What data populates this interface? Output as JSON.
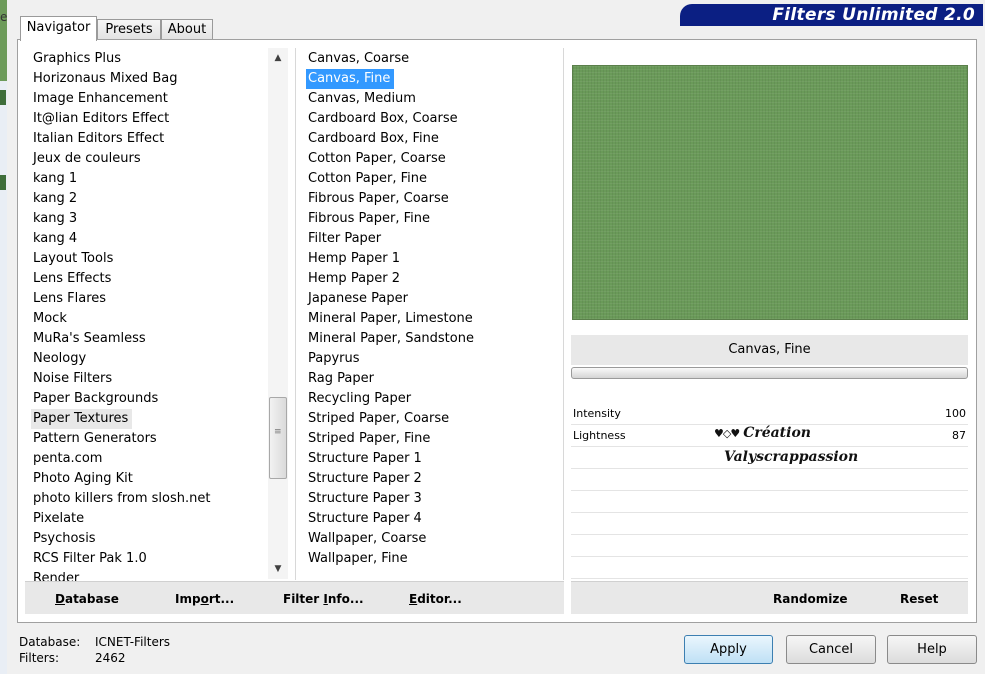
{
  "window": {
    "title": "Filters Unlimited 2.0",
    "edge_char": "e"
  },
  "tabs": [
    {
      "label": "Navigator",
      "active": true
    },
    {
      "label": "Presets",
      "active": false
    },
    {
      "label": "About",
      "active": false
    }
  ],
  "categories": [
    "Graphics Plus",
    "Horizonaus Mixed Bag",
    "Image Enhancement",
    "It@lian Editors Effect",
    "Italian Editors Effect",
    "Jeux de couleurs",
    "kang 1",
    "kang 2",
    "kang 3",
    "kang 4",
    "Layout Tools",
    "Lens Effects",
    "Lens Flares",
    "Mock",
    "MuRa's Seamless",
    "Neology",
    "Noise Filters",
    "Paper Backgrounds",
    "Paper Textures",
    "Pattern Generators",
    "penta.com",
    "Photo Aging Kit",
    "photo killers from slosh.net",
    "Pixelate",
    "Psychosis",
    "RCS Filter Pak 1.0",
    "Render"
  ],
  "selected_category": "Paper Textures",
  "filters": [
    "Canvas, Coarse",
    "Canvas, Fine",
    "Canvas, Medium",
    "Cardboard Box, Coarse",
    "Cardboard Box, Fine",
    "Cotton Paper, Coarse",
    "Cotton Paper, Fine",
    "Fibrous Paper, Coarse",
    "Fibrous Paper, Fine",
    "Filter Paper",
    "Hemp Paper 1",
    "Hemp Paper 2",
    "Japanese Paper",
    "Mineral Paper, Limestone",
    "Mineral Paper, Sandstone",
    "Papyrus",
    "Rag Paper",
    "Recycling Paper",
    "Striped Paper, Coarse",
    "Striped Paper, Fine",
    "Structure Paper 1",
    "Structure Paper 2",
    "Structure Paper 3",
    "Structure Paper 4",
    "Wallpaper, Coarse",
    "Wallpaper, Fine"
  ],
  "selected_filter": "Canvas, Fine",
  "scrollbar": {
    "up_icon": "triangle-up-icon",
    "down_icon": "triangle-down-icon"
  },
  "left_buttons": {
    "database": {
      "u": "D",
      "rest": "atabase"
    },
    "import": {
      "pre": "Imp",
      "u": "o",
      "rest": "rt..."
    },
    "filter_info": {
      "pre": "Filter ",
      "u": "I",
      "rest": "nfo..."
    },
    "editor": {
      "u": "E",
      "rest": "ditor..."
    }
  },
  "preview": {
    "color": "#6a9a59"
  },
  "filter_name": "Canvas, Fine",
  "params": [
    {
      "label": "Intensity",
      "value": "100"
    },
    {
      "label": "Lightness",
      "value": "87"
    }
  ],
  "watermark": {
    "hearts": "♥◇♥",
    "line1": "Création",
    "line2": "Valyscrappassion"
  },
  "right_buttons": {
    "randomize": "Randomize",
    "reset": "Reset"
  },
  "status": {
    "database_label": "Database:",
    "database_value": "ICNET-Filters",
    "filters_label": "Filters:",
    "filters_value": "2462"
  },
  "dialog_buttons": {
    "apply": "Apply",
    "cancel": "Cancel",
    "help": "Help"
  },
  "colors": {
    "selection": "#3399ff",
    "banner": "#0b1f83"
  }
}
